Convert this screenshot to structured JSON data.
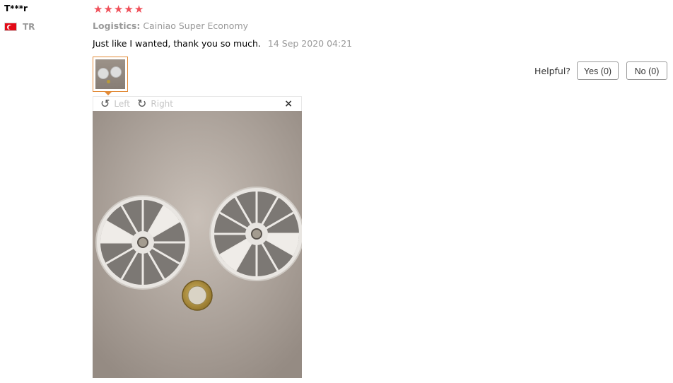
{
  "user": {
    "name": "T***r",
    "country_code": "TR"
  },
  "rating": {
    "stars": 5,
    "max": 5
  },
  "logistics": {
    "label": "Logistics:",
    "value": "Cainiao Super Economy"
  },
  "review": {
    "text": "Just like I wanted, thank you so much.",
    "date": "14 Sep 2020 04:21"
  },
  "viewer": {
    "rotate_left_label": "Left",
    "rotate_right_label": "Right",
    "close_glyph": "×"
  },
  "helpful": {
    "label": "Helpful?",
    "yes_label": "Yes (0)",
    "no_label": "No (0)"
  },
  "colors": {
    "star": "#f0505a",
    "thumb_border": "#e28a37"
  }
}
